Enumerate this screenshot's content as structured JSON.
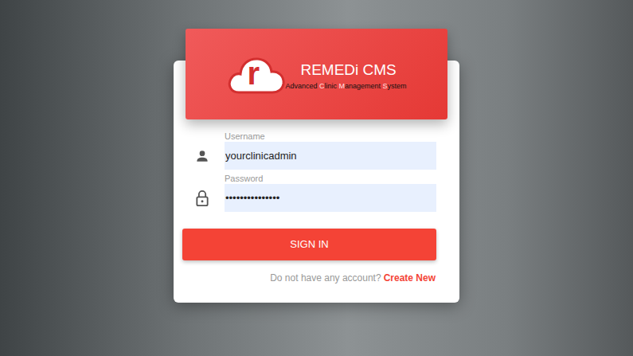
{
  "logo": {
    "mark": "r",
    "title": "REMEDi CMS",
    "subtitle": [
      {
        "text": "Advanced ",
        "highlight": false
      },
      {
        "text": "C",
        "highlight": true
      },
      {
        "text": "linic ",
        "highlight": false
      },
      {
        "text": "M",
        "highlight": true
      },
      {
        "text": "anagement ",
        "highlight": false
      },
      {
        "text": "S",
        "highlight": true
      },
      {
        "text": "ystem",
        "highlight": false
      }
    ]
  },
  "fields": [
    {
      "label": "Username",
      "value": "yourclinicadmin",
      "kind": "text"
    },
    {
      "label": "Password",
      "value": "•••••••••••••••",
      "kind": "password"
    }
  ],
  "button": "SIGN IN",
  "footer": {
    "prompt": "Do not have any account?",
    "link": "Create New"
  }
}
